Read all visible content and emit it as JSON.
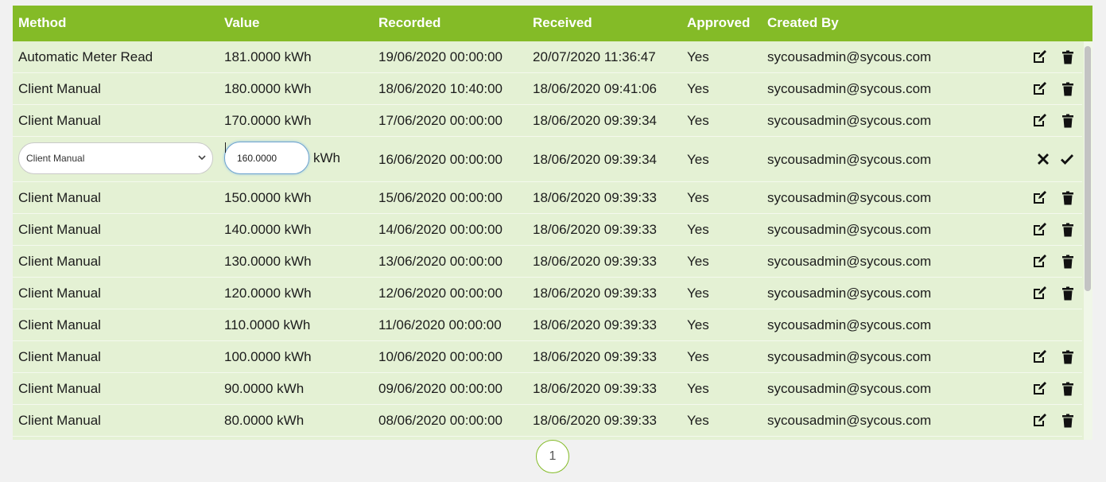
{
  "headers": {
    "method": "Method",
    "value": "Value",
    "recorded": "Recorded",
    "received": "Received",
    "approved": "Approved",
    "created_by": "Created By"
  },
  "rows": [
    {
      "method": "Automatic Meter Read",
      "value": "181.0000 kWh",
      "recorded": "19/06/2020 00:00:00",
      "received": "20/07/2020 11:36:47",
      "approved": "Yes",
      "created_by": "sycousadmin@sycous.com",
      "actions": [
        "edit-icon",
        "trash-icon"
      ]
    },
    {
      "method": "Client Manual",
      "value": "180.0000 kWh",
      "recorded": "18/06/2020 10:40:00",
      "received": "18/06/2020 09:41:06",
      "approved": "Yes",
      "created_by": "sycousadmin@sycous.com",
      "actions": [
        "edit-icon",
        "trash-icon"
      ]
    },
    {
      "method": "Client Manual",
      "value": "170.0000 kWh",
      "recorded": "17/06/2020 00:00:00",
      "received": "18/06/2020 09:39:34",
      "approved": "Yes",
      "created_by": "sycousadmin@sycous.com",
      "actions": [
        "edit-icon",
        "trash-icon"
      ]
    },
    {
      "editing": true,
      "method_selected": "Client Manual",
      "value_input": "160.0000",
      "unit": "kWh",
      "recorded": "16/06/2020 00:00:00",
      "received": "18/06/2020 09:39:34",
      "approved": "Yes",
      "created_by": "sycousadmin@sycous.com",
      "actions": [
        "close-icon",
        "check-icon"
      ]
    },
    {
      "method": "Client Manual",
      "value": "150.0000 kWh",
      "recorded": "15/06/2020 00:00:00",
      "received": "18/06/2020 09:39:33",
      "approved": "Yes",
      "created_by": "sycousadmin@sycous.com",
      "actions": [
        "edit-icon",
        "trash-icon"
      ]
    },
    {
      "method": "Client Manual",
      "value": "140.0000 kWh",
      "recorded": "14/06/2020 00:00:00",
      "received": "18/06/2020 09:39:33",
      "approved": "Yes",
      "created_by": "sycousadmin@sycous.com",
      "actions": [
        "edit-icon",
        "trash-icon"
      ]
    },
    {
      "method": "Client Manual",
      "value": "130.0000 kWh",
      "recorded": "13/06/2020 00:00:00",
      "received": "18/06/2020 09:39:33",
      "approved": "Yes",
      "created_by": "sycousadmin@sycous.com",
      "actions": [
        "edit-icon",
        "trash-icon"
      ]
    },
    {
      "method": "Client Manual",
      "value": "120.0000 kWh",
      "recorded": "12/06/2020 00:00:00",
      "received": "18/06/2020 09:39:33",
      "approved": "Yes",
      "created_by": "sycousadmin@sycous.com",
      "actions": [
        "edit-icon",
        "trash-icon"
      ]
    },
    {
      "method": "Client Manual",
      "value": "110.0000 kWh",
      "recorded": "11/06/2020 00:00:00",
      "received": "18/06/2020 09:39:33",
      "approved": "Yes",
      "created_by": "sycousadmin@sycous.com",
      "actions": []
    },
    {
      "method": "Client Manual",
      "value": "100.0000 kWh",
      "recorded": "10/06/2020 00:00:00",
      "received": "18/06/2020 09:39:33",
      "approved": "Yes",
      "created_by": "sycousadmin@sycous.com",
      "actions": [
        "edit-icon",
        "trash-icon"
      ]
    },
    {
      "method": "Client Manual",
      "value": "90.0000 kWh",
      "recorded": "09/06/2020 00:00:00",
      "received": "18/06/2020 09:39:33",
      "approved": "Yes",
      "created_by": "sycousadmin@sycous.com",
      "actions": [
        "edit-icon",
        "trash-icon"
      ]
    },
    {
      "method": "Client Manual",
      "value": "80.0000 kWh",
      "recorded": "08/06/2020 00:00:00",
      "received": "18/06/2020 09:39:33",
      "approved": "Yes",
      "created_by": "sycousadmin@sycous.com",
      "actions": [
        "edit-icon",
        "trash-icon"
      ]
    }
  ],
  "pagination": {
    "current_page": "1"
  },
  "colors": {
    "header_bg": "#84bb27",
    "row_bg": "#e4f1d4",
    "page_bg": "#f1f1f1"
  }
}
